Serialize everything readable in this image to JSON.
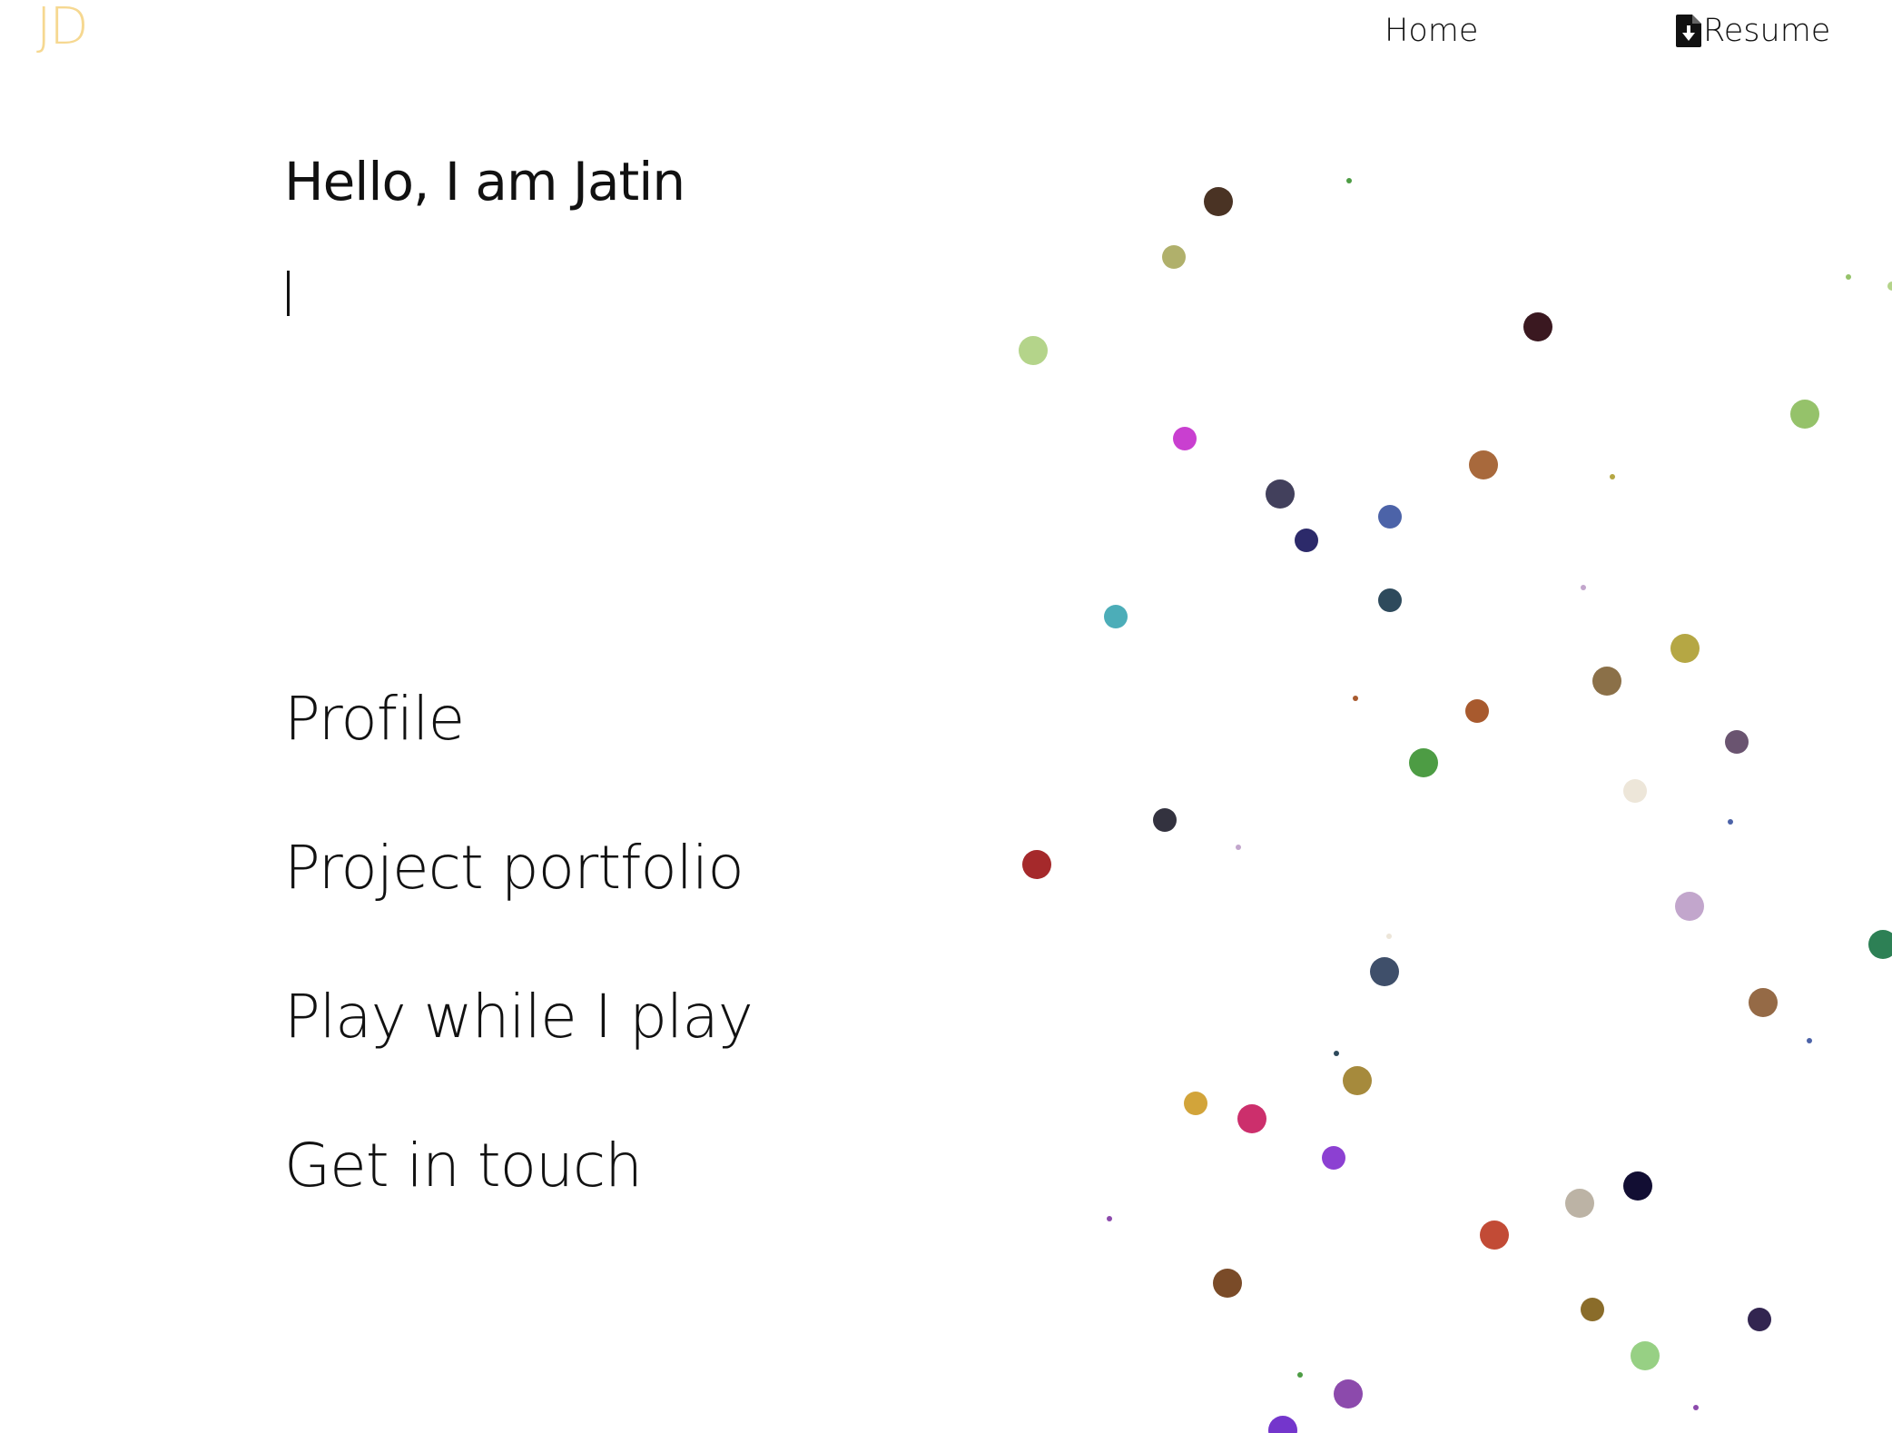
{
  "header": {
    "logo_text": "JD",
    "nav": [
      {
        "label": "Home",
        "icon": ""
      },
      {
        "label": "Resume",
        "icon": "file-download-icon"
      }
    ]
  },
  "hero": {
    "greeting": "Hello, I am Jatin",
    "typed_text": ""
  },
  "menu": [
    {
      "label": "Profile"
    },
    {
      "label": "Project portfolio"
    },
    {
      "label": "Play while I play"
    },
    {
      "label": "Get in touch"
    }
  ],
  "colors": {
    "logo": "#f6d891",
    "text": "#111111",
    "background": "#ffffff",
    "particle_palette": [
      "#4a3324",
      "#b0b06b",
      "#b4d48a",
      "#c93fd0",
      "#42405c",
      "#2c2a6a",
      "#4c63a8",
      "#2e4a5c",
      "#4cadb8",
      "#a5292b",
      "#33323f",
      "#a8693c",
      "#3a1820",
      "#95c26a",
      "#b5a744",
      "#8b7048",
      "#a85a2e",
      "#4d9c44",
      "#ede6d9",
      "#6a5470",
      "#c2a6cc",
      "#3f4f6a",
      "#956a46",
      "#2d8055",
      "#d2a43a",
      "#cc2f6c",
      "#a68a3c",
      "#8c40d2",
      "#7a4b28",
      "#bcb3a5",
      "#120e33",
      "#c24b36",
      "#8a6c2a",
      "#97d084",
      "#322550",
      "#8c4aac",
      "#7436cc"
    ]
  }
}
